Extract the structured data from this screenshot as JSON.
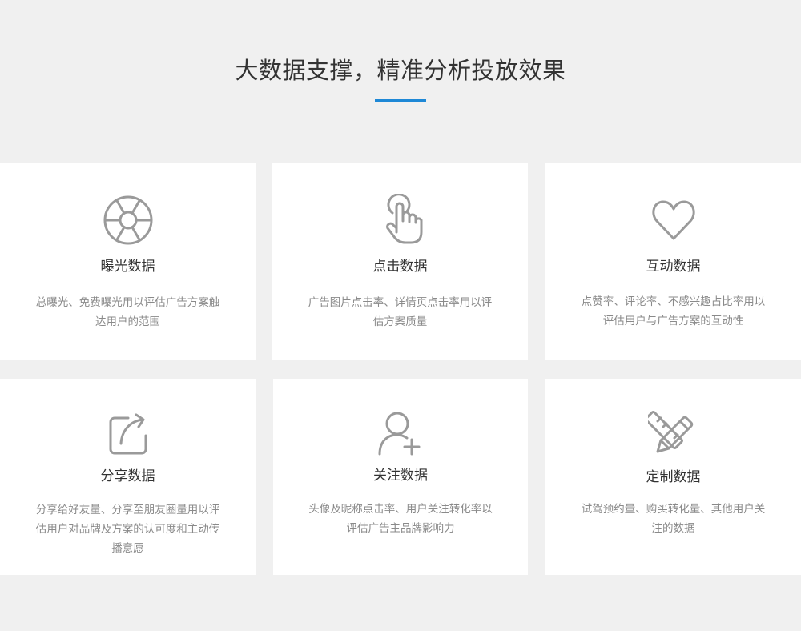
{
  "section": {
    "title": "大数据支撑，精准分析投放效果",
    "accent_color": "#1e88d6"
  },
  "cards": [
    {
      "icon": "aperture-icon",
      "name": "曝光数据",
      "desc": "总曝光、免费曝光用以评估广告方案触达用户的范围"
    },
    {
      "icon": "hand-pointer-icon",
      "name": "点击数据",
      "desc": "广告图片点击率、详情页点击率用以评估方案质量"
    },
    {
      "icon": "heart-icon",
      "name": "互动数据",
      "desc": "点赞率、评论率、不感兴趣占比率用以评估用户与广告方案的互动性"
    },
    {
      "icon": "share-icon",
      "name": "分享数据",
      "desc": "分享给好友量、分享至朋友圈量用以评估用户对品牌及方案的认可度和主动传播意愿"
    },
    {
      "icon": "user-plus-icon",
      "name": "关注数据",
      "desc": "头像及昵称点击率、用户关注转化率以评估广告主品牌影响力"
    },
    {
      "icon": "pencil-ruler-icon",
      "name": "定制数据",
      "desc": "试驾预约量、购买转化量、其他用户关注的数据"
    }
  ]
}
